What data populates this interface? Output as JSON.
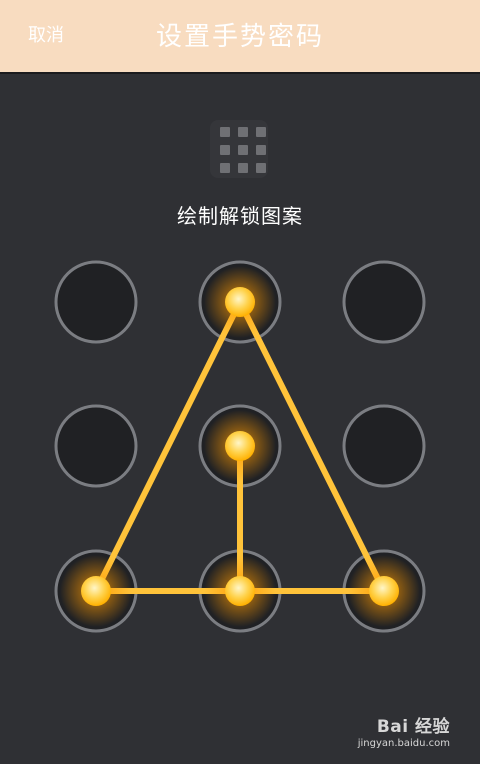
{
  "header": {
    "cancel_label": "取消",
    "title": "设置手势密码"
  },
  "instruction": "绘制解锁图案",
  "pattern": {
    "nodes": [
      1,
      2,
      3,
      4,
      5,
      6,
      7,
      8,
      9
    ],
    "selected_sequence": [
      5,
      8,
      7,
      2,
      9,
      8
    ],
    "line_color": "#ffc33a",
    "glow_color": "#ffb100"
  },
  "watermark": {
    "brand": "Bai 经验",
    "url": "jingyan.baidu.com"
  }
}
